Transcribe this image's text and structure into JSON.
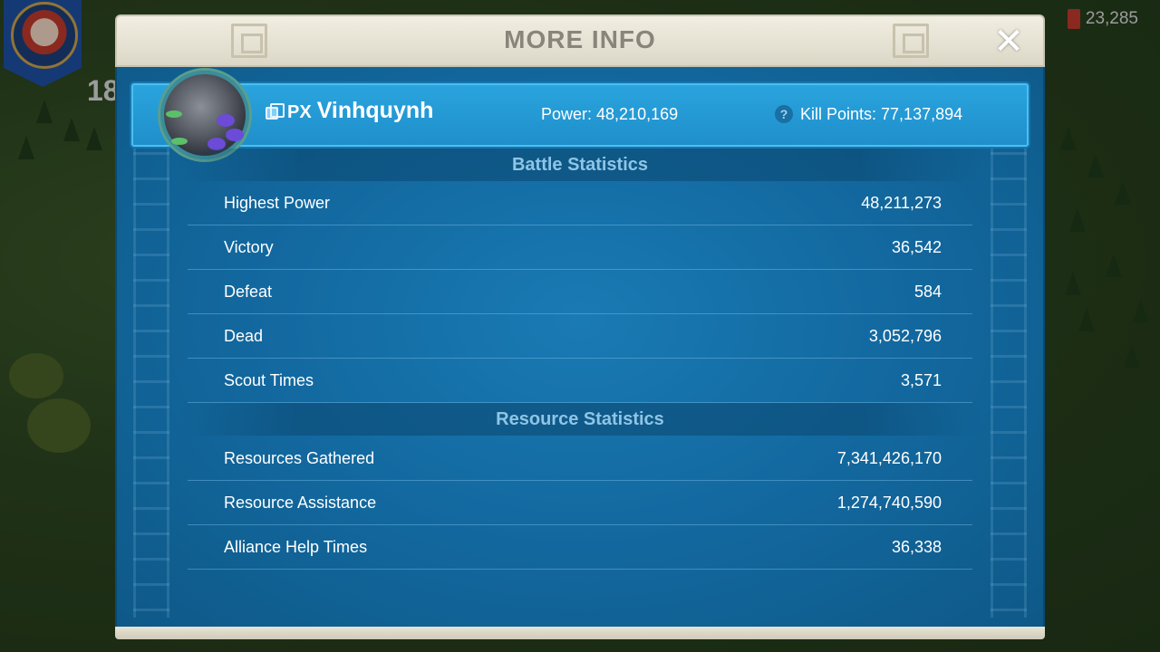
{
  "background": {
    "player_level": "18",
    "gems": "23,285"
  },
  "dialog": {
    "title": "MORE INFO",
    "close_icon": "close-icon"
  },
  "player": {
    "tag": "PX",
    "name": "Vinhquynh",
    "power": "Power: 48,210,169",
    "kill_points": "Kill Points: 77,137,894",
    "help_icon": "?"
  },
  "battle": {
    "header": "Battle Statistics",
    "rows": [
      {
        "label": "Highest Power",
        "value": "48,211,273"
      },
      {
        "label": "Victory",
        "value": "36,542"
      },
      {
        "label": "Defeat",
        "value": "584"
      },
      {
        "label": "Dead",
        "value": "3,052,796"
      },
      {
        "label": "Scout Times",
        "value": "3,571"
      }
    ]
  },
  "resource": {
    "header": "Resource Statistics",
    "rows": [
      {
        "label": "Resources Gathered",
        "value": "7,341,426,170"
      },
      {
        "label": "Resource Assistance",
        "value": "1,274,740,590"
      },
      {
        "label": "Alliance Help Times",
        "value": "36,338"
      }
    ]
  },
  "colors": {
    "panel_blue": "#136aa1",
    "header_bar": "#1f8fcb",
    "section_text": "#8ec5e6",
    "title_text": "#8a857a"
  }
}
